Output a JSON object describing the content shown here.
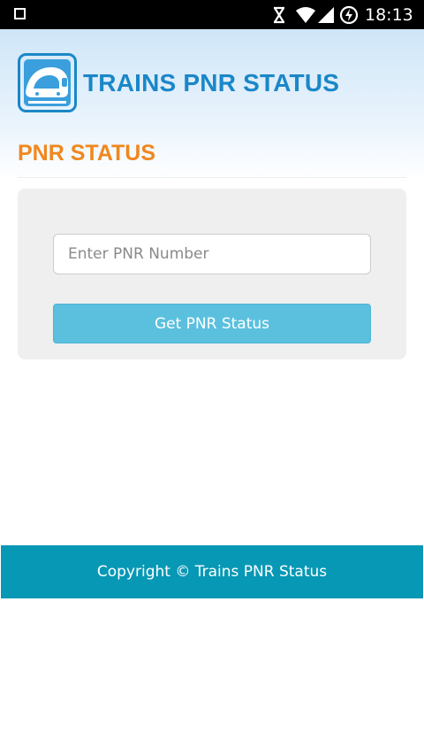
{
  "status_bar": {
    "time": "18:13",
    "icons": [
      "square-icon",
      "sync-icon",
      "wifi-icon",
      "signal-icon",
      "data-saver-icon"
    ]
  },
  "header": {
    "logo_icon": "train-icon",
    "app_title": "TRAINS PNR STATUS",
    "page_title": "PNR STATUS"
  },
  "form": {
    "pnr_input": {
      "placeholder": "Enter PNR Number",
      "value": ""
    },
    "submit_label": "Get PNR Status"
  },
  "footer": {
    "copyright": "Copyright © Trains PNR Status"
  },
  "colors": {
    "brand_blue": "#1a87c8",
    "accent_orange": "#f0871f",
    "button": "#5bc0de",
    "footer": "#0798b5"
  }
}
